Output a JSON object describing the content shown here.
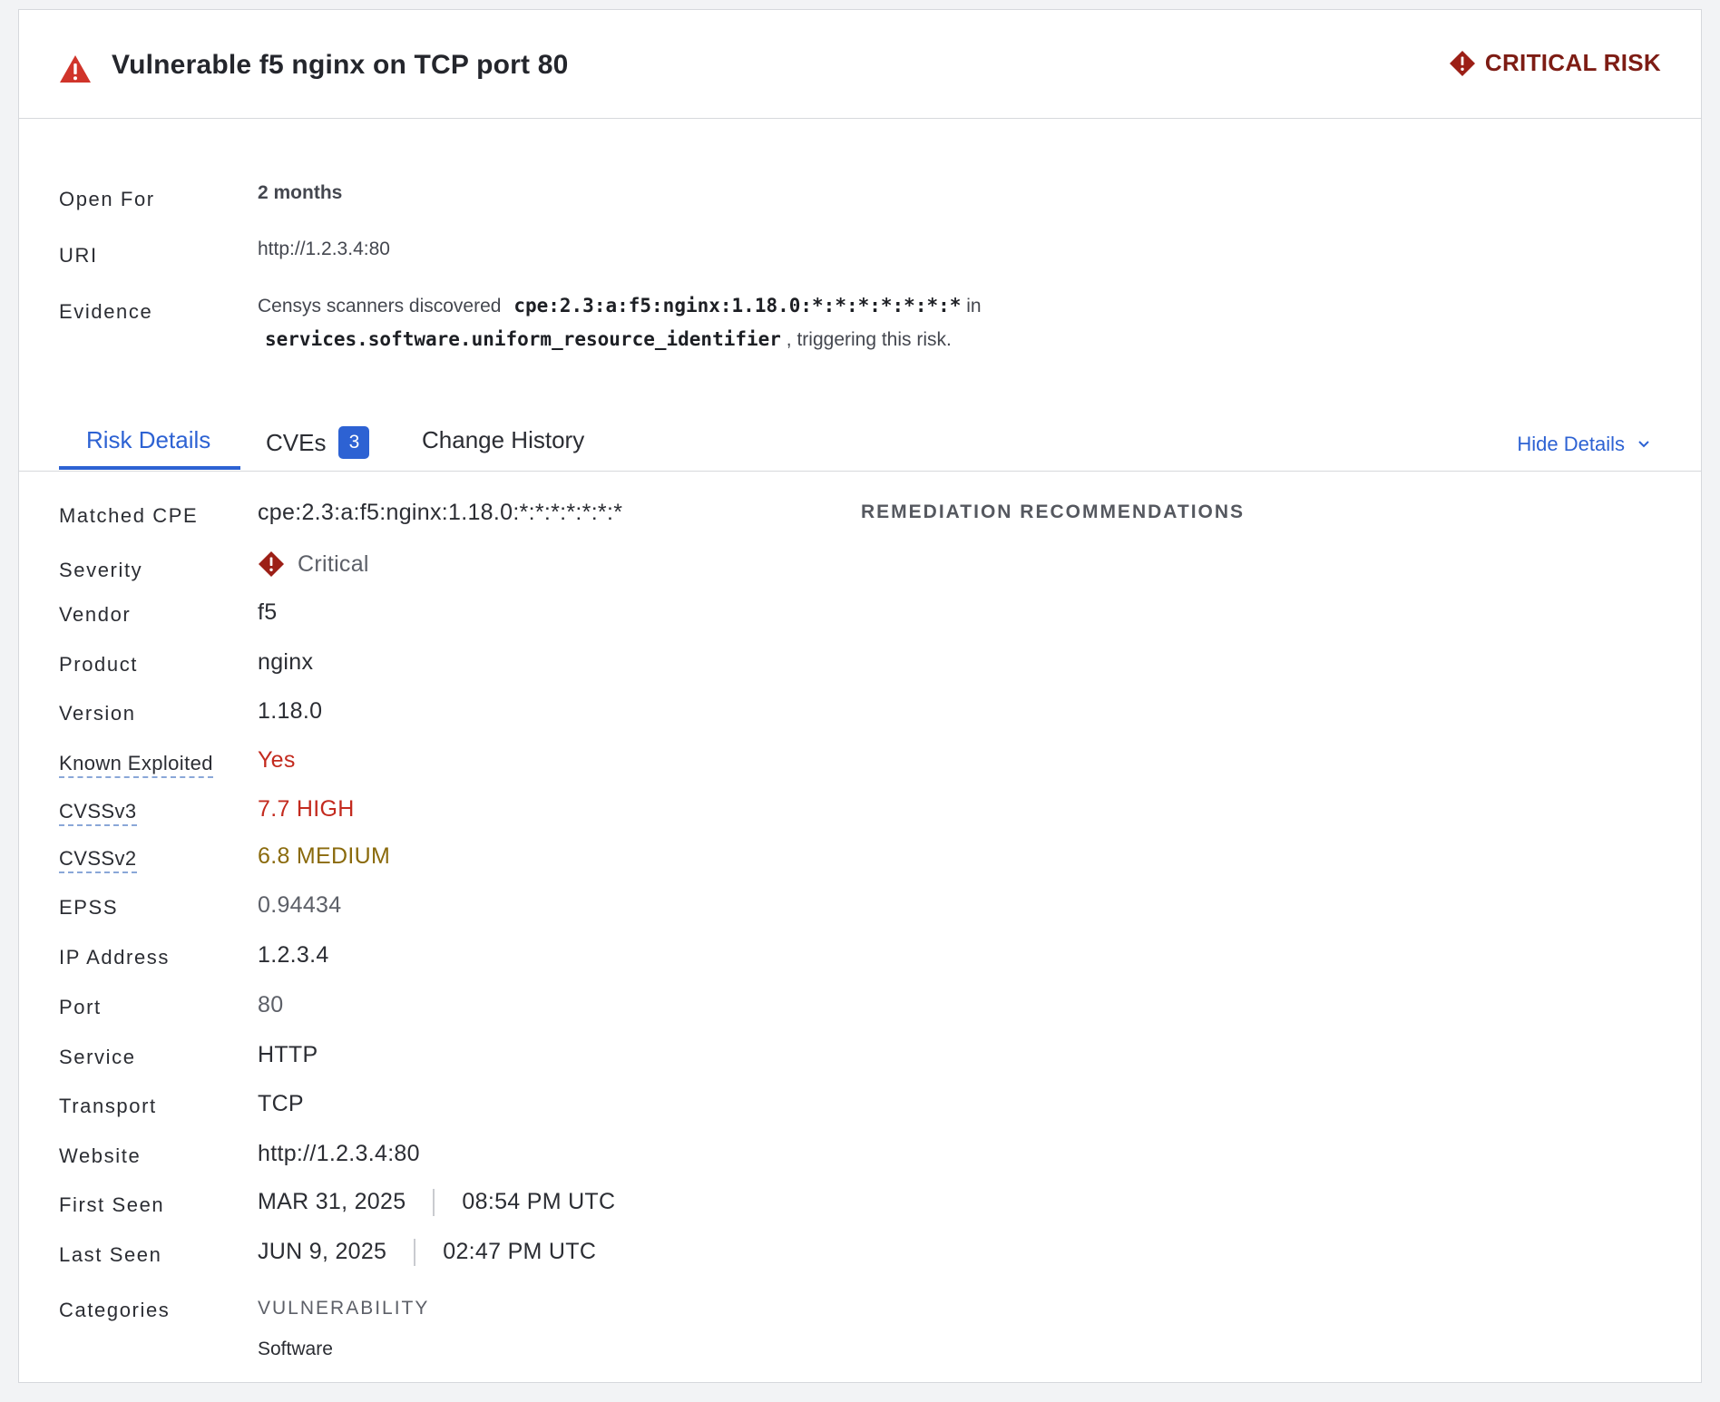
{
  "header": {
    "title": "Vulnerable f5 nginx on TCP port 80",
    "risk_label": "CRITICAL RISK"
  },
  "summary": {
    "open_for": {
      "label": "Open For",
      "value": "2 months"
    },
    "uri": {
      "label": "URI",
      "value": "http://1.2.3.4:80"
    },
    "evidence": {
      "label": "Evidence",
      "prefix": "Censys scanners discovered",
      "cpe": "cpe:2.3:a:f5:nginx:1.18.0:*:*:*:*:*:*:*",
      "in": "in",
      "field": "services.software.uniform_resource_identifier",
      "suffix": ", triggering this risk."
    }
  },
  "tabs": {
    "risk_details": "Risk Details",
    "cves": "CVEs",
    "cves_count": "3",
    "change_history": "Change History",
    "hide_details": "Hide Details"
  },
  "details": {
    "matched_cpe": {
      "label": "Matched CPE",
      "value": "cpe:2.3:a:f5:nginx:1.18.0:*:*:*:*:*:*:*"
    },
    "severity": {
      "label": "Severity",
      "value": "Critical"
    },
    "vendor": {
      "label": "Vendor",
      "value": "f5"
    },
    "product": {
      "label": "Product",
      "value": "nginx"
    },
    "version": {
      "label": "Version",
      "value": "1.18.0"
    },
    "known_exploited": {
      "label": "Known Exploited",
      "value": "Yes"
    },
    "cvssv3": {
      "label": "CVSSv3",
      "value": "7.7 HIGH"
    },
    "cvssv2": {
      "label": "CVSSv2",
      "value": "6.8 MEDIUM"
    },
    "epss": {
      "label": "EPSS",
      "value": "0.94434"
    },
    "ip_address": {
      "label": "IP Address",
      "value": "1.2.3.4"
    },
    "port": {
      "label": "Port",
      "value": "80"
    },
    "service": {
      "label": "Service",
      "value": "HTTP"
    },
    "transport": {
      "label": "Transport",
      "value": "TCP"
    },
    "website": {
      "label": "Website",
      "value": "http://1.2.3.4:80"
    },
    "first_seen": {
      "label": "First Seen",
      "date": "MAR 31, 2025",
      "time": "08:54 PM UTC"
    },
    "last_seen": {
      "label": "Last Seen",
      "date": "JUN 9, 2025",
      "time": "02:47 PM UTC"
    },
    "categories": {
      "label": "Categories",
      "category": "VULNERABILITY",
      "subcategory": "Software"
    }
  },
  "remediation": {
    "title": "REMEDIATION RECOMMENDATIONS"
  },
  "colors": {
    "accent": "#2d62d3",
    "critical": "#7d1c14",
    "high": "#c32a1e",
    "medium": "#8a6a0c"
  },
  "icons": {
    "title_icon": "warning-triangle-icon",
    "risk_icon": "critical-diamond-icon",
    "hide_icon": "chevron-down-icon"
  }
}
